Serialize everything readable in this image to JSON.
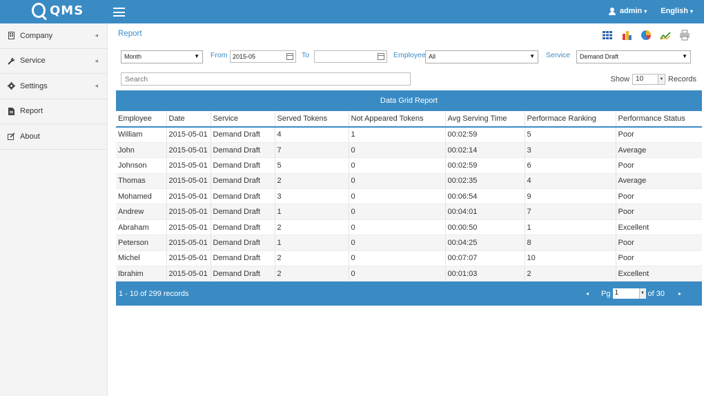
{
  "brand": {
    "name": "QMS"
  },
  "topbar": {
    "user": "admin",
    "language": "English"
  },
  "sidebar": {
    "items": [
      {
        "label": "Company",
        "icon": "building-icon"
      },
      {
        "label": "Service",
        "icon": "wrench-icon"
      },
      {
        "label": "Settings",
        "icon": "gear-icon"
      },
      {
        "label": "Report",
        "icon": "file-icon"
      },
      {
        "label": "About",
        "icon": "edit-icon"
      }
    ]
  },
  "page": {
    "title": "Report"
  },
  "toolbar": {
    "icons": [
      "grid-icon",
      "bar-chart-icon",
      "pie-chart-icon",
      "line-chart-icon",
      "print-icon"
    ]
  },
  "filters": {
    "period_value": "Month",
    "from_label": "From",
    "from_value": "2015-05",
    "to_label": "To",
    "to_value": "",
    "employee_label": "Employee",
    "employee_value": "All",
    "service_label": "Service",
    "service_value": "Demand Draft"
  },
  "search": {
    "placeholder": "Search"
  },
  "show": {
    "label": "Show",
    "value": "10",
    "suffix": "Records"
  },
  "grid": {
    "title": "Data Grid Report",
    "columns": [
      "Employee",
      "Date",
      "Service",
      "Served Tokens",
      "Not Appeared Tokens",
      "Avg Serving Time",
      "Performace Ranking",
      "Performance Status"
    ],
    "rows": [
      [
        "William",
        "2015-05-01",
        "Demand Draft",
        "4",
        "1",
        "00:02:59",
        "5",
        "Poor"
      ],
      [
        "John",
        "2015-05-01",
        "Demand Draft",
        "7",
        "0",
        "00:02:14",
        "3",
        "Average"
      ],
      [
        "Johnson",
        "2015-05-01",
        "Demand Draft",
        "5",
        "0",
        "00:02:59",
        "6",
        "Poor"
      ],
      [
        "Thomas",
        "2015-05-01",
        "Demand Draft",
        "2",
        "0",
        "00:02:35",
        "4",
        "Average"
      ],
      [
        "Mohamed",
        "2015-05-01",
        "Demand Draft",
        "3",
        "0",
        "00:06:54",
        "9",
        "Poor"
      ],
      [
        "Andrew",
        "2015-05-01",
        "Demand Draft",
        "1",
        "0",
        "00:04:01",
        "7",
        "Poor"
      ],
      [
        "Abraham",
        "2015-05-01",
        "Demand Draft",
        "2",
        "0",
        "00:00:50",
        "1",
        "Excellent"
      ],
      [
        "Peterson",
        "2015-05-01",
        "Demand Draft",
        "1",
        "0",
        "00:04:25",
        "8",
        "Poor"
      ],
      [
        "Michel",
        "2015-05-01",
        "Demand Draft",
        "2",
        "0",
        "00:07:07",
        "10",
        "Poor"
      ],
      [
        "Ibrahim",
        "2015-05-01",
        "Demand Draft",
        "2",
        "0",
        "00:01:03",
        "2",
        "Excellent"
      ]
    ],
    "footer": {
      "records": "1 - 10 of 299 records",
      "page_label": "Pg",
      "page_value": "1",
      "of_pages": "of 30"
    }
  },
  "colors": {
    "primary": "#3a8bc4",
    "sidebar_bg": "#f4f4f4",
    "row_alt": "#f5f5f5"
  }
}
